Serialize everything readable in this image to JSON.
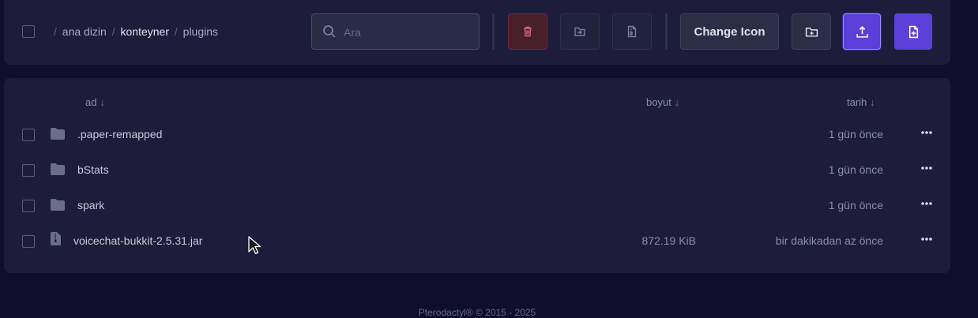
{
  "breadcrumb": {
    "sep": "/",
    "root": "ana dizin",
    "parent": "konteyner",
    "current": "plugins"
  },
  "search": {
    "placeholder": "Ara",
    "value": ""
  },
  "toolbar": {
    "change_icon_label": "Change Icon",
    "icons": [
      "trash-icon",
      "move-icon",
      "archive-icon",
      "new-folder-icon",
      "upload-icon",
      "new-file-icon"
    ]
  },
  "table": {
    "headers": [
      {
        "label": "ad",
        "arrow": "↓"
      },
      {
        "label": "boyut",
        "arrow": "↓"
      },
      {
        "label": "tarih",
        "arrow": "↓"
      }
    ],
    "rows": [
      {
        "type": "folder",
        "name": ".paper-remapped",
        "size": "",
        "date": "1 gün önce"
      },
      {
        "type": "folder",
        "name": "bStats",
        "size": "",
        "date": "1 gün önce"
      },
      {
        "type": "folder",
        "name": "spark",
        "size": "",
        "date": "1 gün önce"
      },
      {
        "type": "file",
        "name": "voicechat-bukkit-2.5.31.jar",
        "size": "872.19 KiB",
        "date": "bir dakikadan az önce"
      }
    ]
  },
  "footer": {
    "text": "Pterodactyl® © 2015 - 2025"
  },
  "colors": {
    "background": "#0f0f2c",
    "panel": "#1d1d3b",
    "accent": "#5b3fd8",
    "danger": "#4a1f2c"
  }
}
